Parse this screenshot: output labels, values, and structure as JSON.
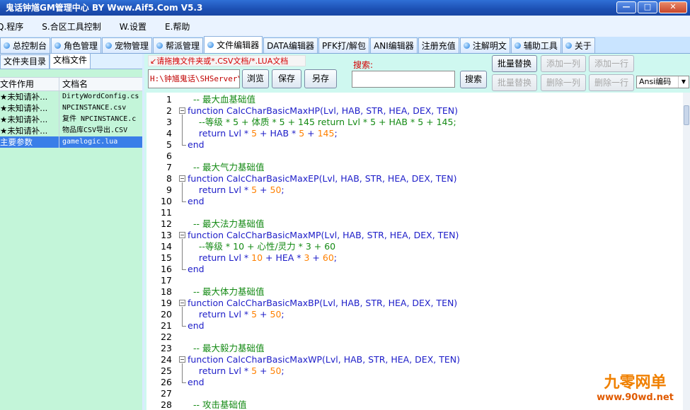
{
  "window": {
    "title": "鬼话钟馗GM管理中心 BY Www.Aif5.Com  V5.3",
    "btn_min": "—",
    "btn_max": "□",
    "btn_close": "✕"
  },
  "menu": [
    "Q.程序",
    "S.合区工具控制",
    "W.设置",
    "E.帮助"
  ],
  "tabs": [
    {
      "label": "总控制台",
      "icon": true
    },
    {
      "label": "角色管理",
      "icon": true
    },
    {
      "label": "宠物管理",
      "icon": true
    },
    {
      "label": "帮派管理",
      "icon": true
    },
    {
      "label": "文件编辑器",
      "icon": true,
      "active": true
    },
    {
      "label": "DATA编辑器",
      "icon": false
    },
    {
      "label": "PFK打/解包",
      "icon": false
    },
    {
      "label": "ANI编辑器",
      "icon": false
    },
    {
      "label": "注册充值",
      "icon": false
    },
    {
      "label": "注解明文",
      "icon": true
    },
    {
      "label": "辅助工具",
      "icon": true
    },
    {
      "label": "关于",
      "icon": true
    }
  ],
  "left_panel": {
    "subtabs": [
      "文件夹目录",
      "文档文件"
    ],
    "headers": [
      "文件作用",
      "文档名"
    ],
    "rows": [
      {
        "purpose": "★未知请补...",
        "file": "DirtyWordConfig.cs"
      },
      {
        "purpose": "★未知请补...",
        "file": "NPCINSTANCE.csv"
      },
      {
        "purpose": "★未知请补...",
        "file": "复件 NPCINSTANCE.c"
      },
      {
        "purpose": "★未知请补...",
        "file": "物品库CSV导出.CSV"
      },
      {
        "purpose": "主要参数",
        "file": "gamelogic.lua",
        "selected": true
      }
    ]
  },
  "toolbar": {
    "hint": "↙请拖拽文件夹或*.CSV文档/*.LUA文档",
    "path": "H:\\钟馗鬼话\\SHServer\\",
    "browse": "浏览",
    "save": "保存",
    "save_as": "另存",
    "search_label": "搜索:",
    "search_value": "",
    "search_btn": "搜索",
    "batch_replace": "批量替换",
    "batch_replace2": "批量替换",
    "add_col": "添加一列",
    "add_row": "添加一行",
    "del_col": "删除一列",
    "del_row": "删除一行",
    "encoding": "Ansi编码"
  },
  "editor": {
    "lines": [
      {
        "n": "1",
        "segs": [
          [
            "cm",
            "  -- 最大血基础值"
          ]
        ]
      },
      {
        "n": "2",
        "segs": [
          [
            "kw",
            "function CalcCharBasicMaxHP(Lvl, HAB, STR, HEA, DEX, TEN)"
          ]
        ],
        "fold": "start"
      },
      {
        "n": "3",
        "segs": [
          [
            "cm",
            "    --等级 * 5 + 体质 * 5 + 145 return Lvl * 5 + HAB * 5 + 145;"
          ]
        ]
      },
      {
        "n": "4",
        "segs": [
          [
            "kw",
            "    return Lvl * "
          ],
          [
            "num",
            "5"
          ],
          [
            "kw",
            " + HAB * "
          ],
          [
            "num",
            "5"
          ],
          [
            "kw",
            " + "
          ],
          [
            "num",
            "145"
          ],
          [
            "kw",
            ";"
          ]
        ]
      },
      {
        "n": "5",
        "segs": [
          [
            "kw",
            "end"
          ]
        ],
        "fold": "end"
      },
      {
        "n": "6",
        "segs": [
          [
            "kw",
            ""
          ]
        ]
      },
      {
        "n": "7",
        "segs": [
          [
            "cm",
            "  -- 最大气力基础值"
          ]
        ]
      },
      {
        "n": "8",
        "segs": [
          [
            "kw",
            "function CalcCharBasicMaxEP(Lvl, HAB, STR, HEA, DEX, TEN)"
          ]
        ],
        "fold": "start"
      },
      {
        "n": "9",
        "segs": [
          [
            "kw",
            "    return Lvl * "
          ],
          [
            "num",
            "5"
          ],
          [
            "kw",
            " + "
          ],
          [
            "num",
            "50"
          ],
          [
            "kw",
            ";"
          ]
        ]
      },
      {
        "n": "10",
        "segs": [
          [
            "kw",
            "end"
          ]
        ],
        "fold": "end"
      },
      {
        "n": "11",
        "segs": [
          [
            "kw",
            ""
          ]
        ]
      },
      {
        "n": "12",
        "segs": [
          [
            "cm",
            "  -- 最大法力基础值"
          ]
        ]
      },
      {
        "n": "13",
        "segs": [
          [
            "kw",
            "function CalcCharBasicMaxMP(Lvl, HAB, STR, HEA, DEX, TEN)"
          ]
        ],
        "fold": "start"
      },
      {
        "n": "14",
        "segs": [
          [
            "cm",
            "    --等级 * 10 + 心性/灵力 * 3 + 60"
          ]
        ]
      },
      {
        "n": "15",
        "segs": [
          [
            "kw",
            "    return Lvl * "
          ],
          [
            "num",
            "10"
          ],
          [
            "kw",
            " + HEA * "
          ],
          [
            "num",
            "3"
          ],
          [
            "kw",
            " + "
          ],
          [
            "num",
            "60"
          ],
          [
            "kw",
            ";"
          ]
        ]
      },
      {
        "n": "16",
        "segs": [
          [
            "kw",
            "end"
          ]
        ],
        "fold": "end"
      },
      {
        "n": "17",
        "segs": [
          [
            "kw",
            ""
          ]
        ]
      },
      {
        "n": "18",
        "segs": [
          [
            "cm",
            "  -- 最大体力基础值"
          ]
        ]
      },
      {
        "n": "19",
        "segs": [
          [
            "kw",
            "function CalcCharBasicMaxBP(Lvl, HAB, STR, HEA, DEX, TEN)"
          ]
        ],
        "fold": "start"
      },
      {
        "n": "20",
        "segs": [
          [
            "kw",
            "    return Lvl * "
          ],
          [
            "num",
            "5"
          ],
          [
            "kw",
            " + "
          ],
          [
            "num",
            "50"
          ],
          [
            "kw",
            ";"
          ]
        ]
      },
      {
        "n": "21",
        "segs": [
          [
            "kw",
            "end"
          ]
        ],
        "fold": "end"
      },
      {
        "n": "22",
        "segs": [
          [
            "kw",
            ""
          ]
        ]
      },
      {
        "n": "23",
        "segs": [
          [
            "cm",
            "  -- 最大毅力基础值"
          ]
        ]
      },
      {
        "n": "24",
        "segs": [
          [
            "kw",
            "function CalcCharBasicMaxWP(Lvl, HAB, STR, HEA, DEX, TEN)"
          ]
        ],
        "fold": "start"
      },
      {
        "n": "25",
        "segs": [
          [
            "kw",
            "    return Lvl * "
          ],
          [
            "num",
            "5"
          ],
          [
            "kw",
            " + "
          ],
          [
            "num",
            "50"
          ],
          [
            "kw",
            ";"
          ]
        ]
      },
      {
        "n": "26",
        "segs": [
          [
            "kw",
            "end"
          ]
        ],
        "fold": "end"
      },
      {
        "n": "27",
        "segs": [
          [
            "kw",
            ""
          ]
        ]
      },
      {
        "n": "28",
        "segs": [
          [
            "cm",
            "  -- 攻击基础值"
          ]
        ]
      }
    ]
  },
  "watermark": {
    "line1": "九零网单",
    "line2": "www.90wd.net"
  }
}
